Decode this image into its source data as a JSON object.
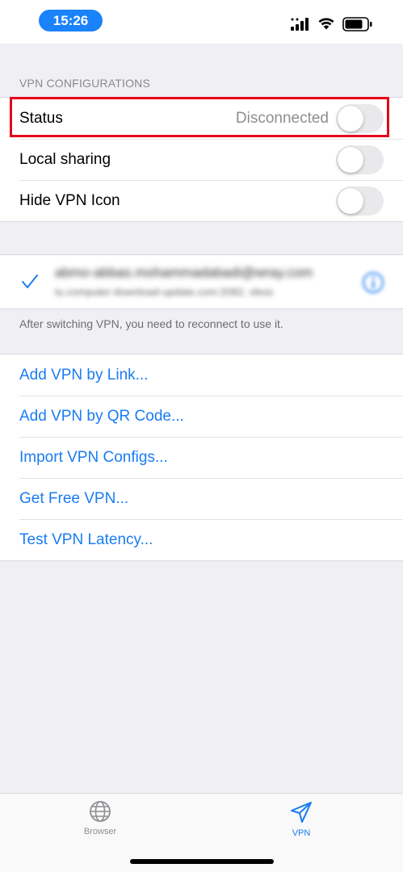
{
  "status_bar": {
    "time": "15:26"
  },
  "vpn_section": {
    "header": "VPN CONFIGURATIONS",
    "rows": [
      {
        "label": "Status",
        "value": "Disconnected",
        "toggle_on": false
      },
      {
        "label": "Local sharing",
        "toggle_on": false
      },
      {
        "label": "Hide VPN Icon",
        "toggle_on": false
      }
    ]
  },
  "config": {
    "title": "abmo-abbas.mohammadabadi@wray.com",
    "subtitle": "tu.computer-download-update.com:2082, vless",
    "selected": true,
    "footer": "After switching VPN, you need to reconnect to use it."
  },
  "actions": [
    {
      "label": "Add VPN by Link..."
    },
    {
      "label": "Add VPN by QR Code..."
    },
    {
      "label": "Import VPN Configs..."
    },
    {
      "label": "Get Free VPN..."
    },
    {
      "label": "Test VPN Latency..."
    }
  ],
  "tab_bar": {
    "tabs": [
      {
        "label": "Browser",
        "icon": "globe-icon",
        "active": false
      },
      {
        "label": "VPN",
        "icon": "paper-plane-icon",
        "active": true
      }
    ]
  },
  "colors": {
    "accent": "#1a7cf2",
    "highlight_border": "#e4001b",
    "time_pill": "#1a82fb"
  }
}
